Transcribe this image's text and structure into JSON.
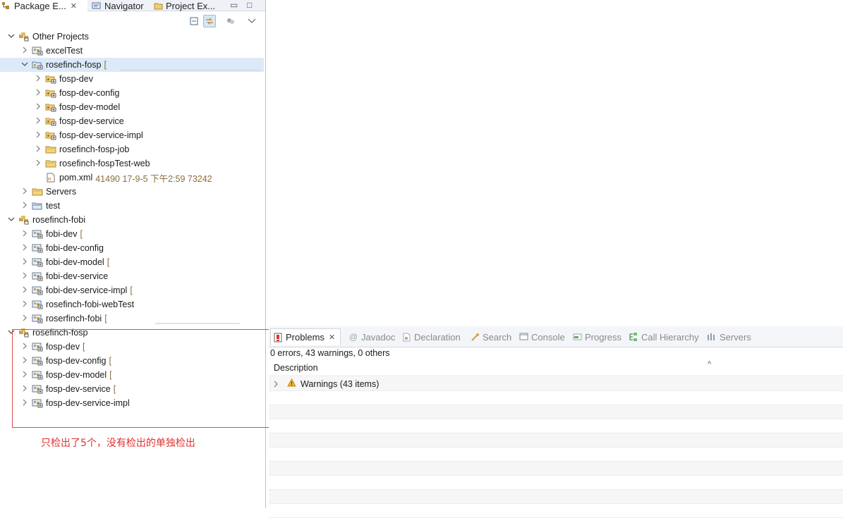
{
  "left_view": {
    "tabs": [
      {
        "label": "Package E...",
        "close": "✕"
      },
      {
        "label": "Navigator"
      },
      {
        "label": "Project Ex..."
      }
    ],
    "window_buttons": {
      "minimize": "▭",
      "maximize": "□"
    },
    "tree": [
      {
        "label": "Other Projects",
        "level": 0,
        "expanded": true,
        "type": "working-set",
        "deco": ""
      },
      {
        "label": "excelTest",
        "level": 1,
        "expanded": false,
        "type": "project",
        "deco": ""
      },
      {
        "label": "rosefinch-fosp",
        "level": 1,
        "expanded": true,
        "type": "project-open",
        "deco": "[",
        "selected": true
      },
      {
        "label": "fosp-dev",
        "level": 2,
        "expanded": false,
        "type": "folder-module",
        "deco": ""
      },
      {
        "label": "fosp-dev-config",
        "level": 2,
        "expanded": false,
        "type": "folder-module",
        "deco": ""
      },
      {
        "label": "fosp-dev-model",
        "level": 2,
        "expanded": false,
        "type": "folder-module",
        "deco": ""
      },
      {
        "label": "fosp-dev-service",
        "level": 2,
        "expanded": false,
        "type": "folder-module",
        "deco": ""
      },
      {
        "label": "fosp-dev-service-impl",
        "level": 2,
        "expanded": false,
        "type": "folder-module",
        "deco": ""
      },
      {
        "label": "rosefinch-fosp-job",
        "level": 2,
        "expanded": false,
        "type": "folder",
        "deco": ""
      },
      {
        "label": "rosefinch-fospTest-web",
        "level": 2,
        "expanded": false,
        "type": "folder",
        "deco": ""
      },
      {
        "label": "pom.xml",
        "level": 2,
        "expanded": null,
        "type": "xml-file",
        "deco": "41490  17-9-5 下午2:59  73242"
      },
      {
        "label": "Servers",
        "level": 1,
        "expanded": false,
        "type": "folder",
        "deco": ""
      },
      {
        "label": "test",
        "level": 1,
        "expanded": false,
        "type": "project-plain",
        "deco": ""
      },
      {
        "label": "rosefinch-fobi",
        "level": 0,
        "expanded": true,
        "type": "working-set",
        "deco": ""
      },
      {
        "label": "fobi-dev",
        "level": 1,
        "expanded": false,
        "type": "project",
        "deco": "["
      },
      {
        "label": "fobi-dev-config",
        "level": 1,
        "expanded": false,
        "type": "project",
        "deco": ""
      },
      {
        "label": "fobi-dev-model",
        "level": 1,
        "expanded": false,
        "type": "project",
        "deco": "["
      },
      {
        "label": "fobi-dev-service",
        "level": 1,
        "expanded": false,
        "type": "project",
        "deco": ""
      },
      {
        "label": "fobi-dev-service-impl",
        "level": 1,
        "expanded": false,
        "type": "project",
        "deco": "["
      },
      {
        "label": "rosefinch-fobi-webTest",
        "level": 1,
        "expanded": false,
        "type": "project",
        "deco": ""
      },
      {
        "label": "roserfinch-fobi",
        "level": 1,
        "expanded": false,
        "type": "project",
        "deco": "["
      },
      {
        "label": "rosefinch-fosp",
        "level": 0,
        "expanded": true,
        "type": "working-set",
        "deco": ""
      },
      {
        "label": "fosp-dev",
        "level": 1,
        "expanded": false,
        "type": "project",
        "deco": "["
      },
      {
        "label": "fosp-dev-config",
        "level": 1,
        "expanded": false,
        "type": "project",
        "deco": "["
      },
      {
        "label": "fosp-dev-model",
        "level": 1,
        "expanded": false,
        "type": "project",
        "deco": "["
      },
      {
        "label": "fosp-dev-service",
        "level": 1,
        "expanded": false,
        "type": "project",
        "deco": "["
      },
      {
        "label": "fosp-dev-service-impl",
        "level": 1,
        "expanded": false,
        "type": "project",
        "deco": ""
      }
    ],
    "icons": [
      "collapse-all-icon",
      "link-with-editor-icon",
      "filter-icon",
      "view-menu-icon"
    ]
  },
  "annotation": {
    "text": "只检出了5个，没有检出的单独检出",
    "color": "#e04848"
  },
  "problems_view": {
    "tabs": [
      {
        "label": "Problems",
        "icon": "problems-icon",
        "active": true,
        "close": "✕"
      },
      {
        "label": "Javadoc",
        "icon": "at-icon"
      },
      {
        "label": "Declaration",
        "icon": "declaration-icon"
      },
      {
        "label": "Search",
        "icon": "search-icon"
      },
      {
        "label": "Console",
        "icon": "console-icon"
      },
      {
        "label": "Progress",
        "icon": "progress-icon"
      },
      {
        "label": "Call Hierarchy",
        "icon": "call-hierarchy-icon"
      },
      {
        "label": "Servers",
        "icon": "servers-icon"
      }
    ],
    "summary": "0 errors, 43 warnings, 0 others",
    "column_header": "Description",
    "sort_indicator": "^",
    "rows": [
      {
        "label": "Warnings (43 items)",
        "icon": "warning-icon",
        "expandable": true
      }
    ],
    "empty_row_count": 9
  },
  "colors": {
    "selection": "#dceaf8",
    "decoration": "#8a6e3d",
    "annotation": "#e04848",
    "warning": "#e8a317"
  }
}
